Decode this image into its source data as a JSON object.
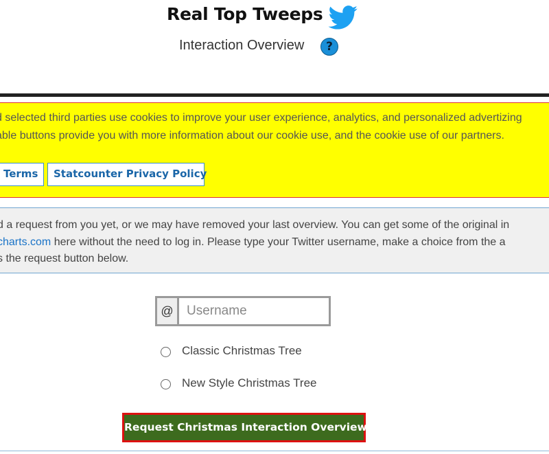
{
  "header": {
    "title": "Real Top Tweeps",
    "subtitle": "Interaction Overview",
    "help_symbol": "?",
    "logo_icon": "twitter-bird-icon",
    "help_icon": "question-circle-icon",
    "brand_color": "#1da1f2"
  },
  "cookie_banner": {
    "line1": "d selected third parties use cookies to improve your user experience, analytics, and personalized advertizing",
    "line2": "able buttons provide you with more information about our cookie use, and the cookie use of our partners.",
    "terms_label": "Terms",
    "privacy_label": "Statcounter Privacy Policy",
    "background": "#ffff00"
  },
  "info": {
    "line1": "d a request from you yet, or we may have removed your last overview. You can get some of the original in",
    "line2_link": "charts.com",
    "line2_rest": " here without the need to log in. Please type your Twitter username, make a choice from the a",
    "line3": "s the request button below."
  },
  "form": {
    "at_symbol": "@",
    "username_placeholder": "Username",
    "username_value": "",
    "options": [
      "Classic Christmas Tree",
      "New Style Christmas Tree"
    ],
    "submit_label": "Request Christmas Interaction Overview",
    "submit_color": "#3d6b1e"
  }
}
